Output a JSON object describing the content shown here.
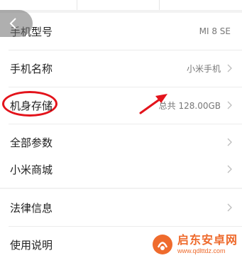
{
  "groups": [
    {
      "rows": [
        {
          "label": "手机型号",
          "value": "MI 8 SE",
          "chevron": false
        },
        {
          "label": "手机名称",
          "value": "小米手机",
          "chevron": true
        },
        {
          "label": "机身存储",
          "value": "总共 128.00GB",
          "chevron": true
        },
        {
          "label": "全部参数",
          "value": "",
          "chevron": true
        }
      ]
    },
    {
      "rows": [
        {
          "label": "小米商城",
          "value": "",
          "chevron": true
        }
      ]
    },
    {
      "rows": [
        {
          "label": "法律信息",
          "value": "",
          "chevron": true
        },
        {
          "label": "使用说明",
          "value": "",
          "chevron": false
        }
      ]
    }
  ],
  "icons": {
    "back": "chevron-left-icon",
    "row_arrow": "chevron-right-icon"
  },
  "annotation": {
    "circled_row": "机身存储",
    "color": "#e3131b"
  },
  "watermark": {
    "name": "启东安卓网",
    "url": "www.qdlttdz.com"
  },
  "colors": {
    "background": "#f2f2f2",
    "card": "#ffffff",
    "watermark": "#ee6a2c"
  }
}
